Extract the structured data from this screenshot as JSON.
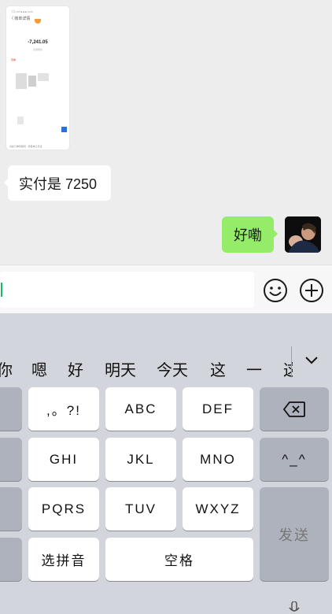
{
  "chat": {
    "screenshot_thumb": {
      "top_text": "下午4:55 ■ ■ ■ 100%",
      "back_label": "〈 账单详情",
      "amount": "-7,241.05",
      "amount_note": "交易成功",
      "red_note": "查看",
      "footer": "对此订单有疑问 · 获取电子凭证"
    },
    "messages": [
      {
        "side": "left",
        "text": "实付是 7250"
      },
      {
        "side": "right",
        "text": "好嘞"
      }
    ]
  },
  "input": {
    "value": ""
  },
  "keyboard": {
    "candidates": [
      "你",
      "嗯",
      "好",
      "明天",
      "今天",
      "这",
      "一",
      "这"
    ],
    "rows": {
      "punct": ",。?!",
      "abc": "ABC",
      "def": "DEF",
      "ghi": "GHI",
      "jkl": "JKL",
      "mno": "MNO",
      "pqrs": "PQRS",
      "tuv": "TUV",
      "wxyz": "WXYZ",
      "select_pinyin": "选拼音",
      "space": "空格",
      "send": "发送",
      "emoji_face": "^_^"
    }
  },
  "colors": {
    "bubble_me": "#95ec69",
    "accent": "#07c160",
    "keyboard_bg": "#d2d5db"
  }
}
